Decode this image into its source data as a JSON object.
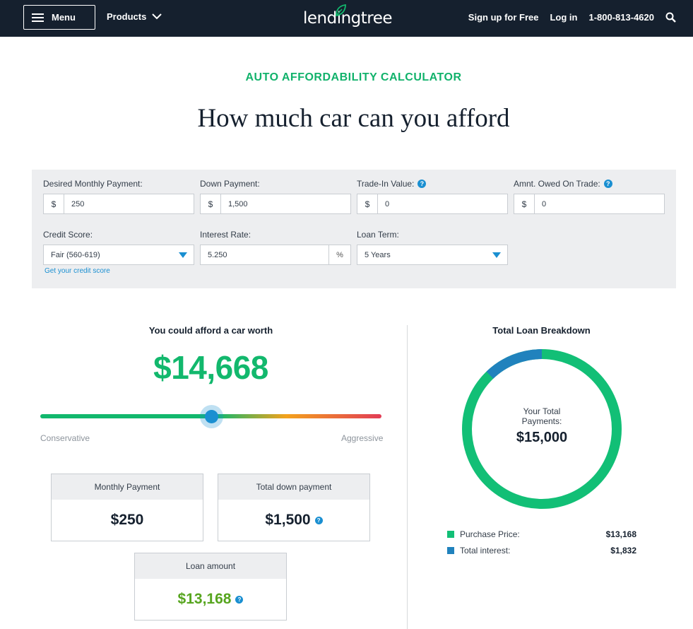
{
  "header": {
    "menu_label": "Menu",
    "products_label": "Products",
    "logo_text": "lendingtree",
    "signup_label": "Sign up for Free",
    "login_label": "Log in",
    "phone": "1-800-813-4620"
  },
  "page": {
    "eyebrow": "AUTO AFFORDABILITY CALCULATOR",
    "title": "How much car can you afford"
  },
  "form": {
    "monthly_payment": {
      "label": "Desired Monthly Payment:",
      "prefix": "$",
      "value": "250"
    },
    "down_payment": {
      "label": "Down Payment:",
      "prefix": "$",
      "value": "1,500"
    },
    "trade_in": {
      "label": "Trade-In Value:",
      "prefix": "$",
      "value": "0",
      "help": "?"
    },
    "amount_owed": {
      "label": "Amnt. Owed On Trade:",
      "prefix": "$",
      "value": "0",
      "help": "?"
    },
    "credit_score": {
      "label": "Credit Score:",
      "value": "Fair (560-619)"
    },
    "interest_rate": {
      "label": "Interest Rate:",
      "value": "5.250",
      "suffix": "%"
    },
    "loan_term": {
      "label": "Loan Term:",
      "value": "5 Years"
    },
    "credit_link": "Get your credit score"
  },
  "result": {
    "title": "You could afford a car worth",
    "value": "$14,668",
    "slider": {
      "position": 0.5,
      "min_label": "Conservative",
      "max_label": "Aggressive"
    },
    "cards": {
      "monthly": {
        "label": "Monthly Payment",
        "value": "$250"
      },
      "down": {
        "label": "Total down payment",
        "value": "$1,500",
        "help": "?"
      },
      "loan": {
        "label": "Loan amount",
        "value": "$13,168",
        "help": "?"
      }
    }
  },
  "breakdown": {
    "title": "Total Loan Breakdown",
    "center_label": "Your Total Payments:",
    "center_value": "$15,000",
    "items": [
      {
        "label": "Purchase Price:",
        "value": "$13,168",
        "amount": 13168,
        "color": "#12bf76"
      },
      {
        "label": "Total interest:",
        "value": "$1,832",
        "amount": 1832,
        "color": "#2082bd"
      }
    ]
  },
  "colors": {
    "accent_green": "#12b86d",
    "accent_blue": "#1a8fd1",
    "header_bg": "#15202e",
    "loan_amount_green": "#57a51f"
  }
}
